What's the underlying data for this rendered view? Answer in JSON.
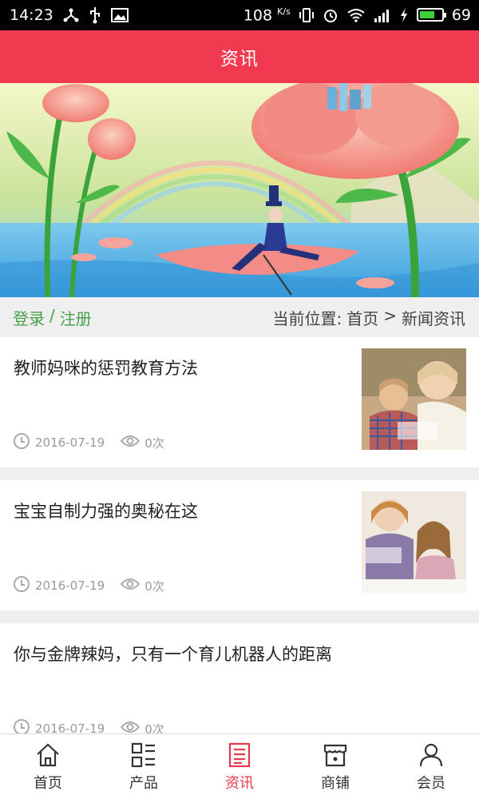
{
  "status_bar": {
    "time": "14:23",
    "net_speed": "108",
    "net_unit": "K/s",
    "battery": "69",
    "battery_level": 0.69
  },
  "header": {
    "title": "资讯"
  },
  "breadcrumb": {
    "login": "登录",
    "separator": "/",
    "register": "注册",
    "location_label": "当前位置:",
    "home": "首页",
    "arrow": ">",
    "current": "新闻资讯"
  },
  "news": [
    {
      "title": "教师妈咪的惩罚教育方法",
      "date": "2016-07-19",
      "views": "0次"
    },
    {
      "title": "宝宝自制力强的奥秘在这",
      "date": "2016-07-19",
      "views": "0次"
    },
    {
      "title": "你与金牌辣妈，只有一个育儿机器人的距离",
      "date": "2016-07-19",
      "views": "0次"
    }
  ],
  "tabs": [
    {
      "label": "首页",
      "icon": "home-icon"
    },
    {
      "label": "产品",
      "icon": "product-grid-icon"
    },
    {
      "label": "资讯",
      "icon": "news-document-icon",
      "active": true
    },
    {
      "label": "商铺",
      "icon": "shop-icon"
    },
    {
      "label": "会员",
      "icon": "member-icon"
    }
  ],
  "colors": {
    "accent": "#f1394f",
    "active_tab": "#e8374d",
    "link_green": "#46a046"
  }
}
